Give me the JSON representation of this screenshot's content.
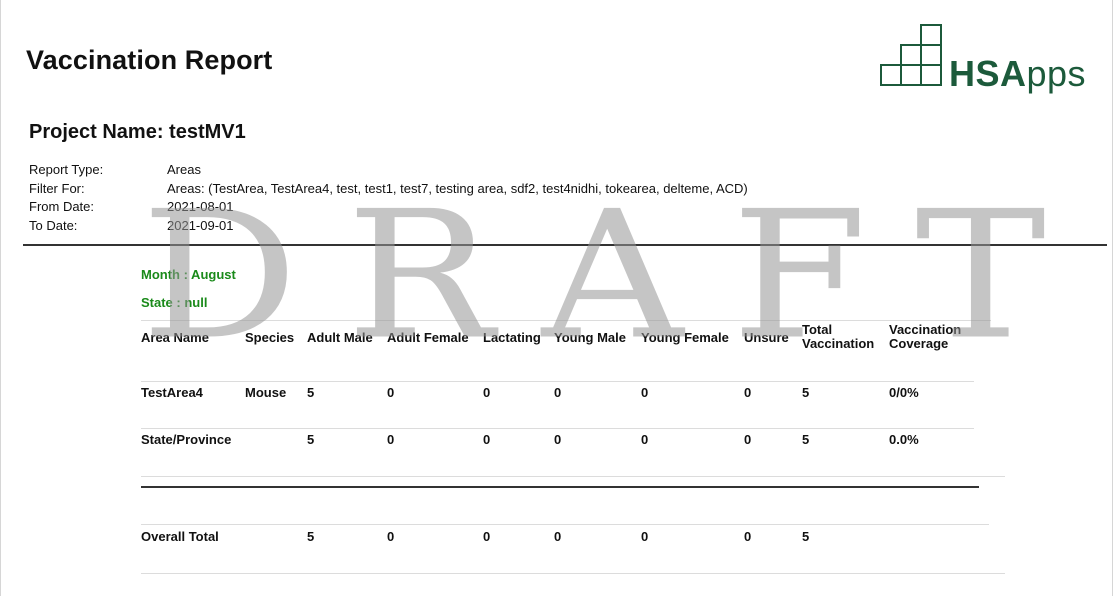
{
  "report": {
    "title": "Vaccination Report",
    "project_label": "Project Name: testMV1"
  },
  "logo": {
    "text_bold": "HSA",
    "text_rest": "pps"
  },
  "meta": [
    {
      "key": "Report Type:",
      "value": "Areas"
    },
    {
      "key": "Filter For:",
      "value": "Areas: (TestArea, TestArea4, test, test1, test7, testing area, sdf2, test4nidhi, tokearea, delteme, ACD)"
    },
    {
      "key": "From Date:",
      "value": "2021-08-01"
    },
    {
      "key": "To Date:",
      "value": "2021-09-01"
    }
  ],
  "watermark": "DRAFT",
  "section": {
    "month": "Month : August",
    "state": "State : null"
  },
  "table": {
    "headers": [
      "Area Name",
      "Species",
      "Adult Male",
      "Adult Female",
      "Lactating",
      "Young Male",
      "Young Female",
      "Unsure",
      "Total\nVaccination",
      "Vaccination\nCoverage"
    ],
    "rows": [
      [
        "TestArea4",
        "Mouse",
        "5",
        "0",
        "0",
        "0",
        "0",
        "0",
        "5",
        "0/0%"
      ],
      [
        "State/Province",
        "",
        "5",
        "0",
        "0",
        "0",
        "0",
        "0",
        "5",
        "0.0%"
      ]
    ],
    "total": [
      "Overall Total",
      "",
      "5",
      "0",
      "0",
      "0",
      "0",
      "0",
      "5",
      ""
    ]
  },
  "colors": {
    "logo_green": "#1c5a3b",
    "section_green": "#1a8a1a",
    "watermark_gray": "#969696"
  }
}
